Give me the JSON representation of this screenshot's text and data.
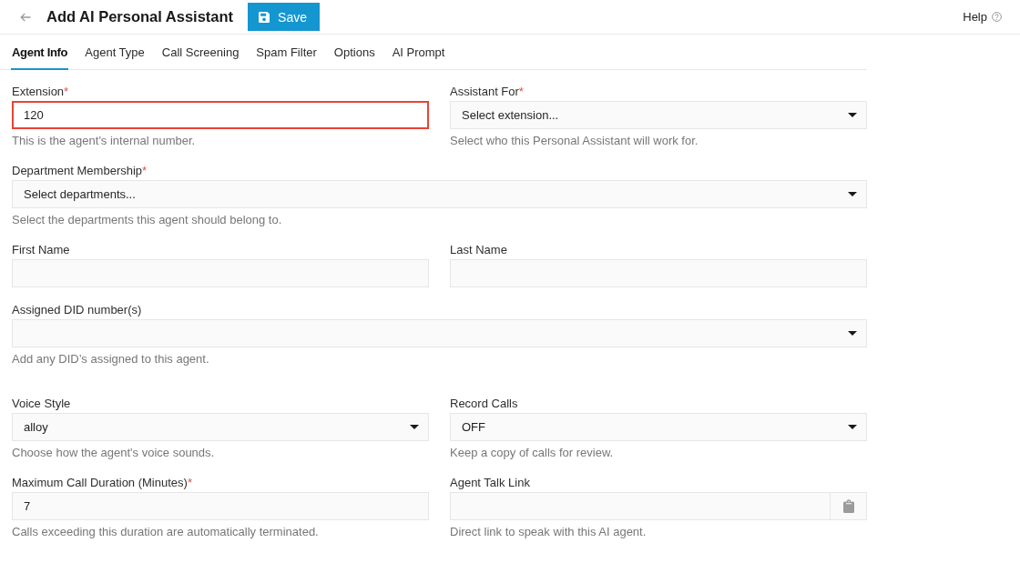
{
  "header": {
    "title": "Add AI Personal Assistant",
    "save_button": "Save",
    "help_link": "Help"
  },
  "tabs": [
    {
      "label": "Agent Info",
      "selected": true
    },
    {
      "label": "Agent Type",
      "selected": false
    },
    {
      "label": "Call Screening",
      "selected": false
    },
    {
      "label": "Spam Filter",
      "selected": false
    },
    {
      "label": "Options",
      "selected": false
    },
    {
      "label": "AI Prompt",
      "selected": false
    }
  ],
  "sections": [
    {
      "rows": [
        {
          "fields": [
            {
              "kind": "text",
              "label": "Extension",
              "required_mark": "*",
              "value": "120",
              "error": true,
              "help": "This is the agent's internal number."
            },
            {
              "kind": "select",
              "label": "Assistant For",
              "required_mark": "*",
              "placeholder": "Select extension...",
              "error": false,
              "help": "Select who this Personal Assistant will work for."
            }
          ]
        },
        {
          "fields": [
            {
              "kind": "select",
              "label": "Department Membership",
              "required_mark": "*",
              "placeholder": "Select departments...",
              "error": false,
              "help": "Select the departments this agent should belong to."
            }
          ]
        },
        {
          "fields": [
            {
              "kind": "text",
              "label": "First Name",
              "error": false
            },
            {
              "kind": "text",
              "label": "Last Name",
              "error": false
            }
          ]
        },
        {
          "fields": [
            {
              "kind": "select",
              "label": "Assigned DID number(s)",
              "error": false,
              "help": "Add any DID’s assigned to this agent."
            }
          ]
        }
      ]
    },
    {
      "rows": [
        {
          "fields": [
            {
              "kind": "select",
              "label": "Voice Style",
              "value": "alloy",
              "error": false,
              "help": "Choose how the agent's voice sounds."
            },
            {
              "kind": "select",
              "label": "Record Calls",
              "value": "OFF",
              "error": false,
              "help": "Keep a copy of calls for review."
            }
          ]
        },
        {
          "fields": [
            {
              "kind": "text",
              "label": "Maximum Call Duration (Minutes)",
              "required_mark": "*",
              "value": "7",
              "error": false,
              "help": "Calls exceeding this duration are automatically terminated."
            },
            {
              "kind": "link",
              "label": "Agent Talk Link",
              "error": false,
              "help": "Direct link to speak with this AI agent."
            }
          ]
        }
      ]
    }
  ]
}
